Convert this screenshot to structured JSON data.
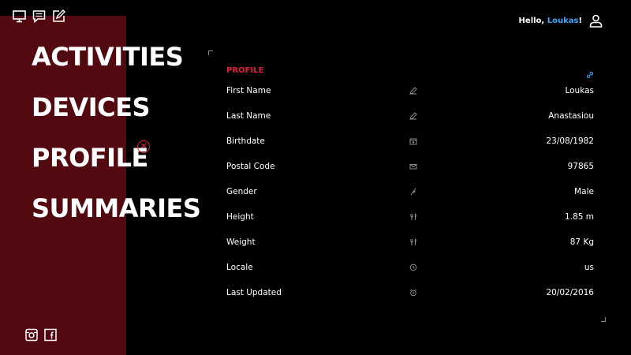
{
  "top_icons": [
    "desktop-icon",
    "chat-icon",
    "edit-icon"
  ],
  "nav": {
    "items": [
      {
        "label": "ACTIVITIES",
        "active": false
      },
      {
        "label": "DEVICES",
        "active": false
      },
      {
        "label": "PROFILE",
        "active": true
      },
      {
        "label": "SUMMARIES",
        "active": false
      }
    ],
    "active_marker": "⊗"
  },
  "bottom_icons": [
    "instagram-icon",
    "facebook-icon"
  ],
  "header": {
    "greeting_prefix": "Hello, ",
    "username": "Loukas",
    "greeting_suffix": "!"
  },
  "profile": {
    "title": "PROFILE",
    "rows": [
      {
        "label": "First Name",
        "icon": "pencil-icon",
        "value": "Loukas"
      },
      {
        "label": "Last Name",
        "icon": "pencil-icon",
        "value": "Anastasiou"
      },
      {
        "label": "Birthdate",
        "icon": "calendar-icon",
        "value": "23/08/1982"
      },
      {
        "label": "Postal Code",
        "icon": "envelope-icon",
        "value": "97865"
      },
      {
        "label": "Gender",
        "icon": "feather-icon",
        "value": "Male"
      },
      {
        "label": "Height",
        "icon": "cutlery-icon",
        "value": "1.85 m"
      },
      {
        "label": "Weight",
        "icon": "cutlery-icon",
        "value": "87 Kg"
      },
      {
        "label": "Locale",
        "icon": "clock-icon",
        "value": "us"
      },
      {
        "label": "Last Updated",
        "icon": "alarm-icon",
        "value": "20/02/2016"
      }
    ]
  },
  "colors": {
    "sidebar": "#520a10",
    "accent_red": "#e0203a",
    "link_blue": "#3ea6ff",
    "background": "#000000"
  }
}
